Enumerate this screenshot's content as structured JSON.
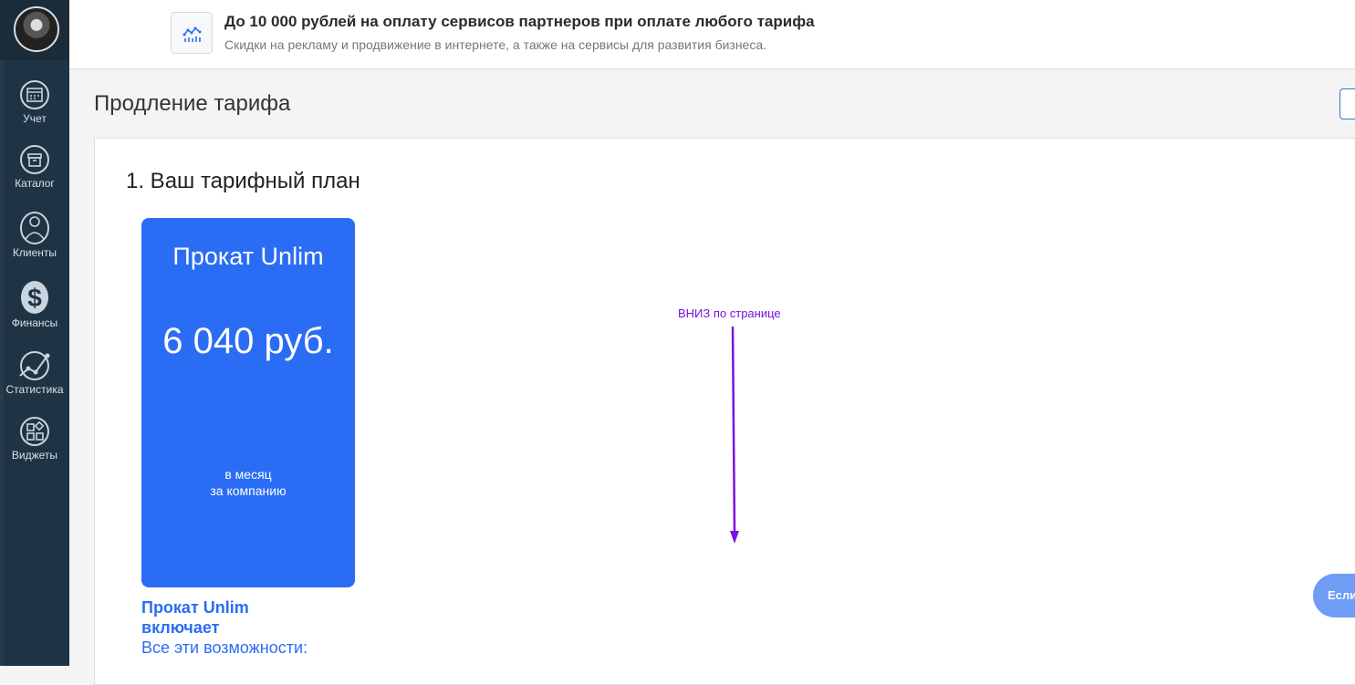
{
  "sidebar": {
    "items": [
      {
        "label": "Учет",
        "icon": "calendar-icon"
      },
      {
        "label": "Каталог",
        "icon": "box-icon"
      },
      {
        "label": "Клиенты",
        "icon": "person-icon"
      },
      {
        "label": "Финансы",
        "icon": "dollar-icon"
      },
      {
        "label": "Статистика",
        "icon": "chart-icon"
      },
      {
        "label": "Виджеты",
        "icon": "widgets-icon"
      }
    ]
  },
  "promo": {
    "icon": "chart-icon",
    "title": "До 10 000 рублей на оплату сервисов партнеров при оплате любого тарифа",
    "subtitle": "Скидки на рекламу и продвижение в интернете, а также на сервисы для развития бизнеса."
  },
  "page": {
    "title": "Продление тарифа"
  },
  "section": {
    "title": "1. Ваш тарифный план"
  },
  "tariff": {
    "name": "Прокат Unlim",
    "price": "6 040 руб.",
    "period_line1": "в месяц",
    "period_line2": "за компанию",
    "includes_title": "Прокат Unlim включает",
    "includes_subtitle": "Все эти возможности:",
    "color": "#2a6df4"
  },
  "annotation": {
    "text": "ВНИЗ по странице",
    "color": "#7b10e0"
  },
  "chat": {
    "label": "Если"
  }
}
